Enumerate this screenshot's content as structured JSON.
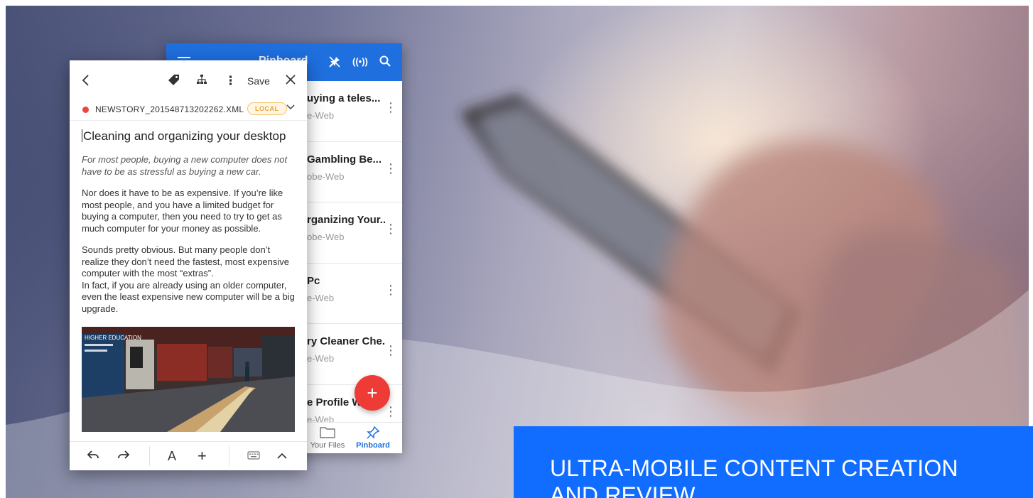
{
  "colors": {
    "accent_blue": "#1f6fde",
    "caption_blue": "#116dff",
    "fab_red": "#ef3b36",
    "record_red": "#e8463e",
    "local_badge_orange": "#e8a23a"
  },
  "file_list_panel": {
    "header_title": "Pinboard",
    "header_icons": [
      "menu-icon",
      "pin-off-icon",
      "broadcast-icon",
      "search-icon"
    ],
    "items": [
      {
        "title": "uying a teles...",
        "subtitle": "e-Web"
      },
      {
        "title": "Gambling Be...",
        "subtitle": "obe-Web"
      },
      {
        "title": "rganizing Your...",
        "subtitle": "obe-Web"
      },
      {
        "title": "Pc",
        "subtitle": "e-Web"
      },
      {
        "title": "ry Cleaner Che...",
        "subtitle": "e-Web"
      },
      {
        "title": "e Profile W",
        "subtitle": "e-Web"
      }
    ],
    "fab_label": "+",
    "bottom_nav": [
      {
        "label": "Your Files",
        "icon": "folder-icon",
        "active": false
      },
      {
        "label": "Pinboard",
        "icon": "pin-icon",
        "active": true
      }
    ]
  },
  "editor_panel": {
    "toolbar": {
      "back_icon": "chevron-left-icon",
      "tag_icon": "tag-icon",
      "hierarchy_icon": "hierarchy-icon",
      "more_icon": "more-vertical-icon",
      "save_label": "Save",
      "close_icon": "close-icon"
    },
    "file": {
      "name": "NEWSTORY_201548713202262.XML",
      "badge": "LOCAL"
    },
    "document": {
      "title": "Cleaning and organizing your desktop",
      "lead": "For most people, buying a new computer does not have to be as stressful as buying a new car.",
      "paragraph1": "Nor does it have to be as expensive. If you’re like most people, and you have a limited budget for buying a computer, then you need to try to get as much computer for your money as possible.",
      "paragraph2": "Sounds pretty obvious. But many people don’t realize they don’t need the fastest, most expensive computer with the most “extras”.",
      "paragraph3": "In fact, if you are already using an older computer, even the least expensive new computer will be a big upgrade."
    },
    "photo": {
      "poster_text": "HIGHER EDUCATION"
    },
    "bottom_bar": {
      "undo_icon": "undo-icon",
      "redo_icon": "redo-icon",
      "font_label": "A",
      "insert_label": "+",
      "keyboard_icon": "keyboard-icon",
      "collapse_icon": "chevron-up-icon"
    }
  },
  "caption": {
    "text": "ULTRA-MOBILE CONTENT CREATION AND REVIEW"
  }
}
